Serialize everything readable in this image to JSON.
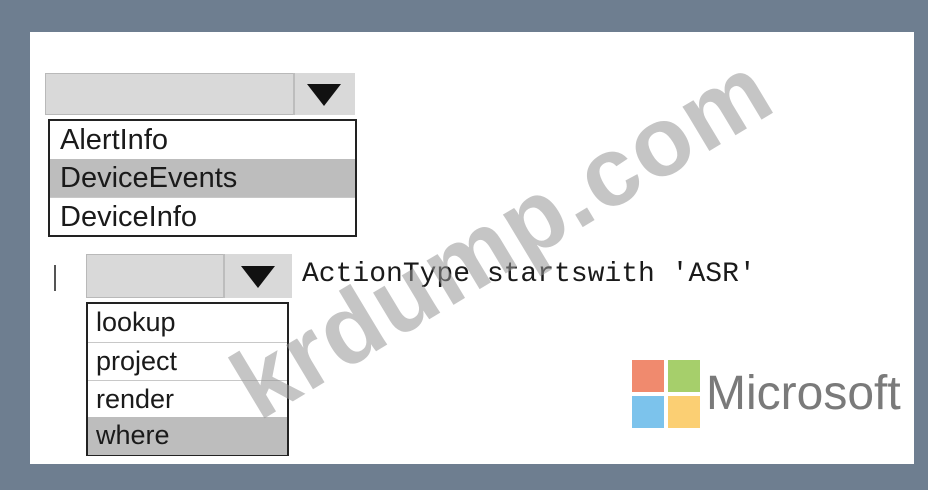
{
  "dropdown1": {
    "selected": "",
    "options": [
      "AlertInfo",
      "DeviceEvents",
      "DeviceInfo"
    ]
  },
  "dropdown2": {
    "selected": "",
    "options": [
      "lookup",
      "project",
      "render",
      "where"
    ]
  },
  "query": {
    "text": "ActionType startswith 'ASR'"
  },
  "logo": {
    "text": "Microsoft",
    "colors": [
      "#f25022",
      "#7fba00",
      "#00a4ef",
      "#ffb900"
    ]
  },
  "watermark": {
    "text": "krdump.com"
  },
  "colors": {
    "frame": "#6e7e90",
    "panel": "#ffffff",
    "dropdown_bg": "#d9d9d9",
    "selected_row": "#bdbdbd"
  }
}
